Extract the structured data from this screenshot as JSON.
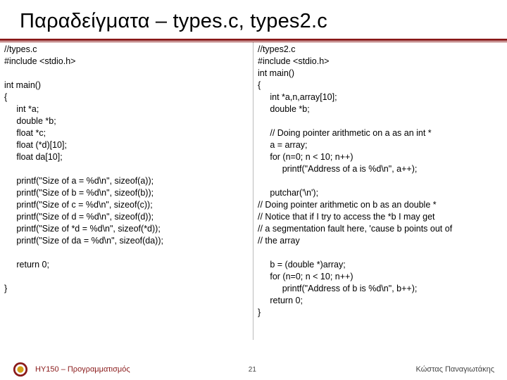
{
  "title": "Παραδείγματα – types.c, types2.c",
  "left_code": "//types.c\n#include <stdio.h>\n\nint main()\n{\n     int *a;\n     double *b;\n     float *c;\n     float (*d)[10];\n     float da[10];\n\n     printf(\"Size of a = %d\\n\", sizeof(a));\n     printf(\"Size of b = %d\\n\", sizeof(b));\n     printf(\"Size of c = %d\\n\", sizeof(c));\n     printf(\"Size of d = %d\\n\", sizeof(d));\n     printf(\"Size of *d = %d\\n\", sizeof(*d));\n     printf(\"Size of da = %d\\n\", sizeof(da));\n\n     return 0;\n\n}",
  "right_code": "//types2.c\n#include <stdio.h>\nint main()\n{\n     int *a,n,array[10];\n     double *b;\n\n     // Doing pointer arithmetic on a as an int *\n     a = array;\n     for (n=0; n < 10; n++)\n          printf(\"Address of a is %d\\n\", a++);\n\n     putchar('\\n');\n// Doing pointer arithmetic on b as an double *\n// Notice that if I try to access the *b I may get\n// a segmentation fault here, 'cause b points out of\n// the array\n\n     b = (double *)array;\n     for (n=0; n < 10; n++)\n          printf(\"Address of b is %d\\n\", b++);\n     return 0;\n}",
  "footer": {
    "course": "ΗΥ150 – Προγραμματισμός",
    "page": "21",
    "author": "Κώστας Παναγιωτάκης"
  }
}
